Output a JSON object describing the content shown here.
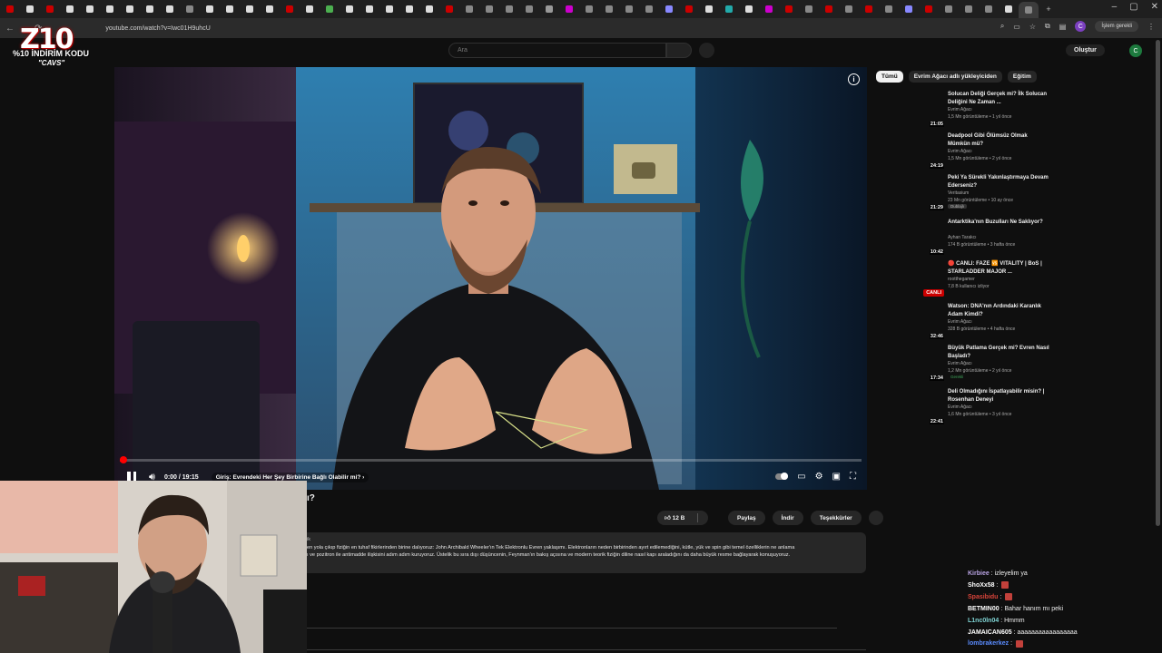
{
  "browser": {
    "url": "youtube.com/watch?v=Iwc01H9uhcU",
    "profile_button": "İşlem gerekli",
    "profile_avatar": "C",
    "tab_count": 52
  },
  "overlay": {
    "logo_text": "Z10",
    "discount_text": "%10 İNDİRİM KODU",
    "code_text": "\"CAVS\""
  },
  "youtube": {
    "search_placeholder": "Ara",
    "create_label": "Oluştur",
    "avatar_letter": "C"
  },
  "player": {
    "time": "0:00 / 19:15",
    "chapter": "Giriş: Evrendeki Her Şey Birbirine Bağlı Olabilir mi?",
    "chapter_arrow": "›",
    "progress_fraction": 0.005
  },
  "below": {
    "title_fragment": "ı?",
    "like_count": "12 B",
    "share": "Paylaş",
    "download": "İndir",
    "thanks": "Teşekkürler",
    "desc_k": "ik",
    "desc_line1": "en yola çıkıp fiziğin en tuhaf fikirlerinden birine dalıyoruz: John Archibald Wheeler'ın Tek Elektronlu Evren yaklaşımı. Elektronların neden birbirinden ayırt edilemediğini, kütle, yük ve spin gibi temel özelliklerin ne anlama",
    "desc_line2": "ı ve pozitron ile antimadde ilişkisini adım adım kuruyoruz. Üstelik bu sıra dışı düşüncenin, Feynman'ın bakış açısına ve modern teorik fiziğin diline nasıl kapı araladığını da daha büyük resme bağlayarak konuşuyoruz."
  },
  "chips": [
    "Tümü",
    "Evrim Ağacı adlı yükleyiciden",
    "Eğitim"
  ],
  "recommended": [
    {
      "title": "Solucan Deliği Gerçek mi? İlk Solucan Deliğini Ne Zaman ...",
      "channel": "Evrim Ağacı",
      "meta": "1,5 Mn görüntüleme • 1 yıl önce",
      "duration": "21:05",
      "badge": "",
      "thumb_color": "#1b2a3b"
    },
    {
      "title": "Deadpool Gibi Ölümsüz Olmak Mümkün mü?",
      "channel": "Evrim Ağacı",
      "meta": "1,5 Mn görüntüleme • 2 yıl önce",
      "duration": "24:19",
      "badge": "",
      "thumb_color": "#3a1f1f"
    },
    {
      "title": "Peki Ya Sürekli Yakınlaştırmaya Devam Ederseniz?",
      "channel": "Veritasium",
      "meta": "23 Mn görüntüleme • 10 ay önce",
      "duration": "21:29",
      "badge": "Dublajlı",
      "thumb_color": "#2b3a2b"
    },
    {
      "title": "Antarktika'nın Buzulları Ne Saklıyor?",
      "channel": "Ayhan Tarakcı",
      "meta": "174 B görüntüleme • 3 hafta önce",
      "duration": "10:42",
      "badge": "",
      "thumb_color": "#cfd8e3"
    },
    {
      "title": "🔴 CANLI: FAZE 🆚 VITALITY | BoS | STARLADDER MAJOR ...",
      "channel": "rootthegamer",
      "meta": "7,8 B kullanıcı izliyor",
      "duration": "CANLI",
      "badge": "",
      "thumb_color": "#1e1e2e"
    },
    {
      "title": "Watson: DNA'nın Ardındaki Karanlık Adam Kimdi?",
      "channel": "Evrim Ağacı",
      "meta": "328 B görüntüleme • 4 hafta önce",
      "duration": "32:46",
      "badge": "",
      "thumb_color": "#2e2418"
    },
    {
      "title": "Büyük Patlama Gerçek mi? Evren Nasıl Başladı?",
      "channel": "Evrim Ağacı",
      "meta": "1,2 Mn görüntüleme • 2 yıl önce",
      "duration": "17:34",
      "badge": "Gerekli",
      "thumb_color": "#14263a"
    },
    {
      "title": "Deli Olmadığını İspatlayabilir misin? | Rosenhan Deneyi",
      "channel": "Evrim Ağacı",
      "meta": "1,6 Mn görüntüleme • 3 yıl önce",
      "duration": "22:41",
      "badge": "",
      "thumb_color": "#2a2a2a"
    }
  ],
  "chat": [
    {
      "user": "Kirbiee",
      "text": "izleyelim ya",
      "color": "#b9a3e3",
      "emote": false
    },
    {
      "user": "ShoXx58",
      "text": "",
      "color": "#ffffff",
      "emote": true
    },
    {
      "user": "Spasibidu",
      "text": "",
      "color": "#d9443a",
      "emote": true
    },
    {
      "user": "BETMIN00",
      "text": "Bahar hanım mı peki",
      "color": "#ffffff",
      "emote": false
    },
    {
      "user": "L1nc0ln04",
      "text": "Hmmm",
      "color": "#7fd3d3",
      "emote": false
    },
    {
      "user": "JAMAICAN605",
      "text": "aaaaaaaaaaaaaaaaa",
      "color": "#ffffff",
      "emote": false
    },
    {
      "user": "lombrakerkez",
      "text": "",
      "color": "#5b8cff",
      "emote": true
    }
  ],
  "colors": {
    "bg": "#0f0f0f",
    "accent_red": "#ff0000",
    "chip_bg": "#272727"
  }
}
